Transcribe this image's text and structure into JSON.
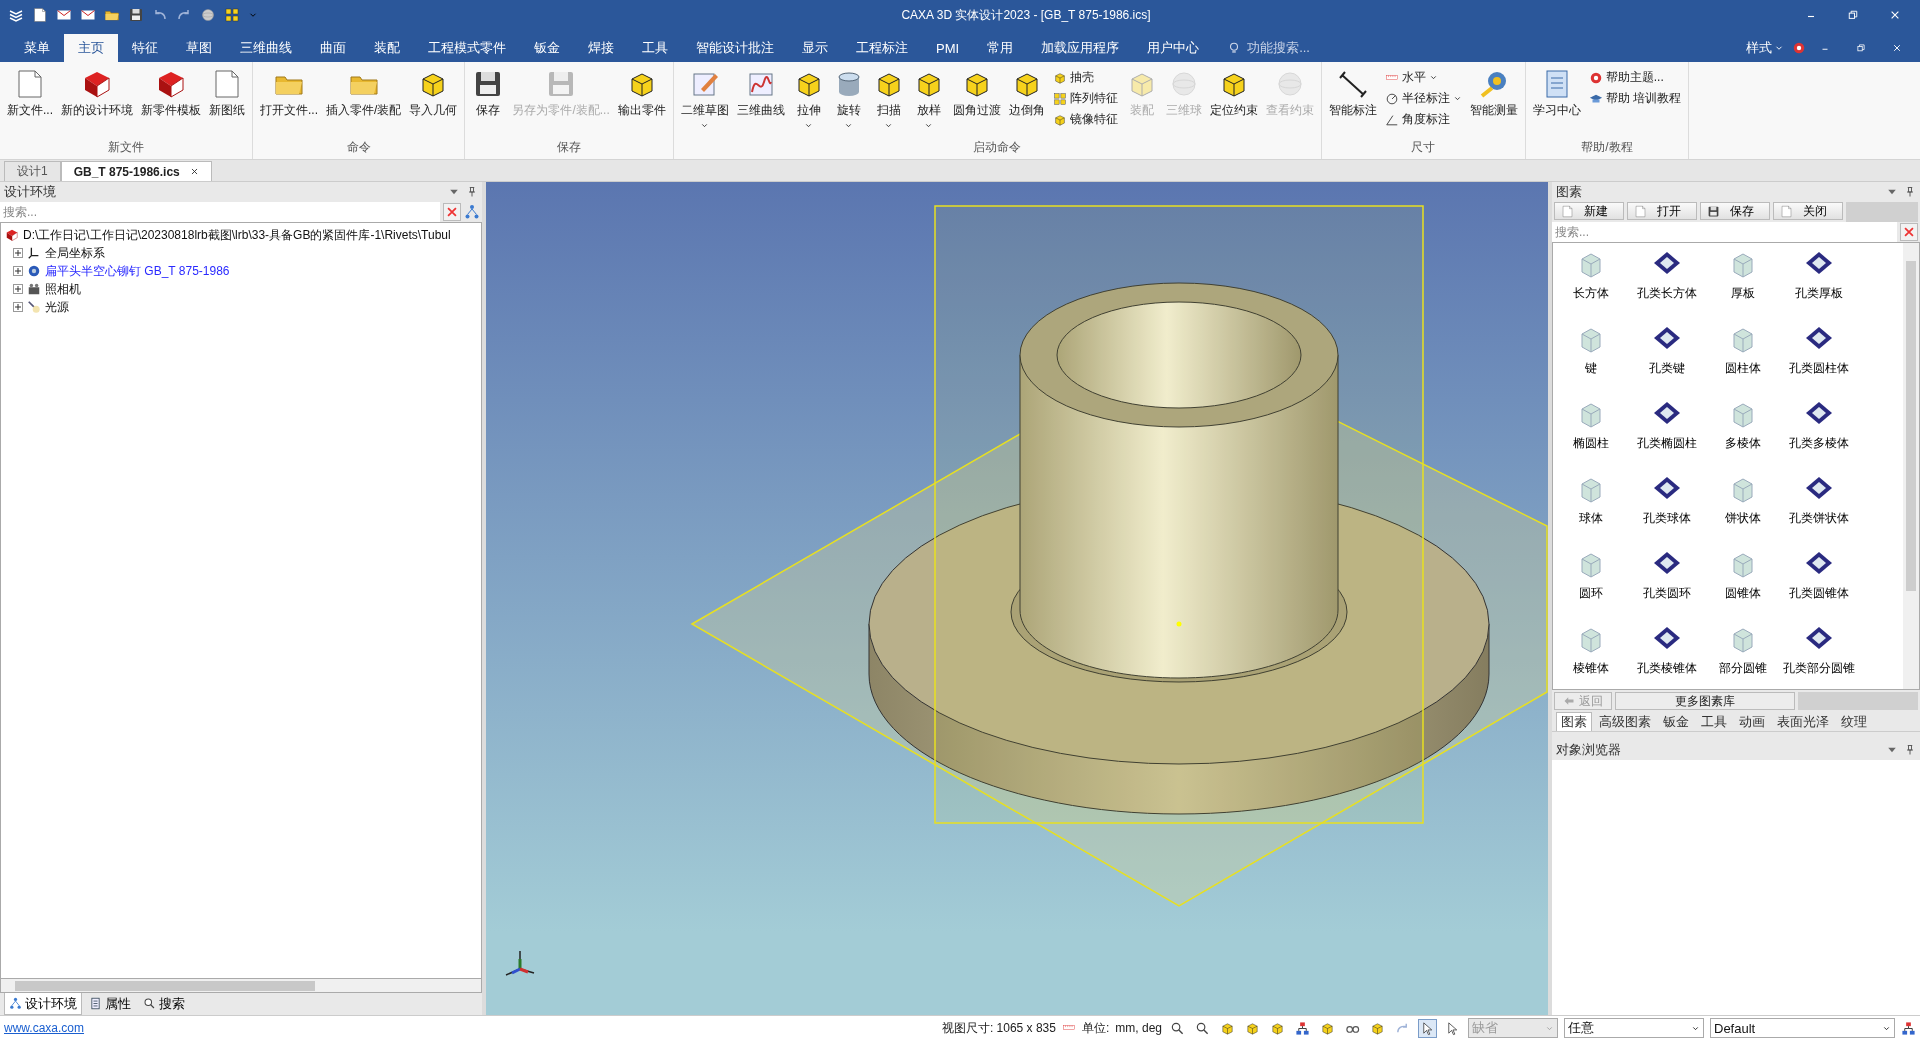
{
  "title_bar": {
    "title": "CAXA 3D 实体设计2023 - [GB_T 875-1986.ics]"
  },
  "menu_tabs": [
    {
      "label": "菜单",
      "selected": false
    },
    {
      "label": "主页",
      "selected": true
    },
    {
      "label": "特征",
      "selected": false
    },
    {
      "label": "草图",
      "selected": false
    },
    {
      "label": "三维曲线",
      "selected": false
    },
    {
      "label": "曲面",
      "selected": false
    },
    {
      "label": "装配",
      "selected": false
    },
    {
      "label": "工程模式零件",
      "selected": false
    },
    {
      "label": "钣金",
      "selected": false
    },
    {
      "label": "焊接",
      "selected": false
    },
    {
      "label": "工具",
      "selected": false
    },
    {
      "label": "智能设计批注",
      "selected": false
    },
    {
      "label": "显示",
      "selected": false
    },
    {
      "label": "工程标注",
      "selected": false
    },
    {
      "label": "PMI",
      "selected": false
    },
    {
      "label": "常用",
      "selected": false
    },
    {
      "label": "加载应用程序",
      "selected": false
    },
    {
      "label": "用户中心",
      "selected": false
    }
  ],
  "feature_search": {
    "placeholder": "功能搜索..."
  },
  "style_menu": {
    "label": "样式"
  },
  "ribbon": {
    "groups": [
      {
        "label": "新文件",
        "items": [
          {
            "kind": "large",
            "label": "新文件...",
            "caret": false,
            "disabled": false
          },
          {
            "kind": "large",
            "label": "新的设计环境",
            "caret": false,
            "disabled": false
          },
          {
            "kind": "large",
            "label": "新零件模板",
            "caret": false,
            "disabled": false
          },
          {
            "kind": "large",
            "label": "新图纸",
            "caret": false,
            "disabled": false
          }
        ]
      },
      {
        "label": "命令",
        "items": [
          {
            "kind": "large",
            "label": "打开文件...",
            "caret": false,
            "disabled": false
          },
          {
            "kind": "large",
            "label": "插入零件/装配",
            "caret": false,
            "disabled": false
          },
          {
            "kind": "large",
            "label": "导入几何",
            "caret": false,
            "disabled": false
          }
        ]
      },
      {
        "label": "保存",
        "items": [
          {
            "kind": "large",
            "label": "保存",
            "caret": false,
            "disabled": false
          },
          {
            "kind": "large",
            "label": "另存为零件/装配...",
            "caret": false,
            "disabled": true
          },
          {
            "kind": "large",
            "label": "输出零件",
            "caret": false,
            "disabled": false
          }
        ]
      },
      {
        "label": "启动命令",
        "items": [
          {
            "kind": "large",
            "label": "二维草图",
            "caret": true,
            "disabled": false
          },
          {
            "kind": "large",
            "label": "三维曲线",
            "caret": false,
            "disabled": false
          },
          {
            "kind": "large",
            "label": "拉伸",
            "caret": true,
            "disabled": false
          },
          {
            "kind": "large",
            "label": "旋转",
            "caret": true,
            "disabled": false
          },
          {
            "kind": "large",
            "label": "扫描",
            "caret": true,
            "disabled": false
          },
          {
            "kind": "large",
            "label": "放样",
            "caret": true,
            "disabled": false
          },
          {
            "kind": "large",
            "label": "圆角过渡",
            "caret": false,
            "disabled": false
          },
          {
            "kind": "large",
            "label": "边倒角",
            "caret": false,
            "disabled": false
          },
          {
            "kind": "stack",
            "items": [
              {
                "label": "抽壳",
                "caret": false,
                "disabled": false
              },
              {
                "label": "阵列特征",
                "caret": false,
                "disabled": false
              },
              {
                "label": "镜像特征",
                "caret": false,
                "disabled": false
              }
            ]
          },
          {
            "kind": "large",
            "label": "装配",
            "caret": false,
            "disabled": true
          },
          {
            "kind": "large",
            "label": "三维球",
            "caret": false,
            "disabled": true
          },
          {
            "kind": "large",
            "label": "定位约束",
            "caret": false,
            "disabled": false
          },
          {
            "kind": "large",
            "label": "查看约束",
            "caret": false,
            "disabled": true
          }
        ]
      },
      {
        "label": "尺寸",
        "items": [
          {
            "kind": "large",
            "label": "智能标注",
            "caret": false,
            "disabled": false
          },
          {
            "kind": "stack",
            "items": [
              {
                "label": "水平",
                "caret": true,
                "disabled": false
              },
              {
                "label": "半径标注",
                "caret": true,
                "disabled": false
              },
              {
                "label": "角度标注",
                "caret": false,
                "disabled": false
              }
            ]
          },
          {
            "kind": "large",
            "label": "智能测量",
            "caret": false,
            "disabled": false
          }
        ]
      },
      {
        "label": "帮助/教程",
        "items": [
          {
            "kind": "large",
            "label": "学习中心",
            "caret": false,
            "disabled": false
          },
          {
            "kind": "stack",
            "items": [
              {
                "label": "帮助主题...",
                "caret": false,
                "disabled": false
              },
              {
                "label": "帮助 培训教程",
                "caret": false,
                "disabled": false
              }
            ]
          }
        ]
      }
    ]
  },
  "doc_tabs": [
    {
      "label": "设计1",
      "selected": false,
      "closable": false
    },
    {
      "label": "GB_T 875-1986.ics",
      "selected": true,
      "closable": true
    }
  ],
  "left_panel": {
    "title": "设计环境",
    "search": {
      "placeholder": "搜索..."
    },
    "tree": {
      "label": "D:\\工作日记\\工作日记\\20230818lrb截图\\lrb\\33-具备GB的紧固件库-1\\Rivets\\Tubul",
      "children": [
        {
          "label": "全局坐标系",
          "expanded": false,
          "highlighted": false
        },
        {
          "label": "扁平头半空心铆钉 GB_T 875-1986",
          "expanded": false,
          "highlighted": true
        },
        {
          "label": "照相机",
          "expanded": false,
          "highlighted": false
        },
        {
          "label": "光源",
          "expanded": false,
          "highlighted": false
        }
      ]
    },
    "bottom_tabs": [
      {
        "label": "设计环境",
        "selected": true
      },
      {
        "label": "属性",
        "selected": false
      },
      {
        "label": "搜索",
        "selected": false
      }
    ]
  },
  "right_panel": {
    "title": "图素",
    "buttons": [
      "新建",
      "打开",
      "保存",
      "关闭"
    ],
    "search": {
      "placeholder": "搜索..."
    },
    "items": [
      "长方体",
      "孔类长方体",
      "厚板",
      "孔类厚板",
      "键",
      "孔类键",
      "圆柱体",
      "孔类圆柱体",
      "椭圆柱",
      "孔类椭圆柱",
      "多棱体",
      "孔类多棱体",
      "球体",
      "孔类球体",
      "饼状体",
      "孔类饼状体",
      "圆环",
      "孔类圆环",
      "圆锥体",
      "孔类圆锥体",
      "棱锥体",
      "孔类棱锥体",
      "部分圆锥",
      "孔类部分圆锥"
    ],
    "back": {
      "label": "返回",
      "disabled": true
    },
    "more": {
      "label": "更多图素库"
    },
    "tabs": [
      {
        "label": "图素",
        "selected": true
      },
      {
        "label": "高级图素",
        "selected": false
      },
      {
        "label": "钣金",
        "selected": false
      },
      {
        "label": "工具",
        "selected": false
      },
      {
        "label": "动画",
        "selected": false
      },
      {
        "label": "表面光泽",
        "selected": false
      },
      {
        "label": "纹理",
        "selected": false
      }
    ],
    "object_browser": {
      "title": "对象浏览器"
    }
  },
  "status_bar": {
    "link": "www.caxa.com",
    "view_size": "视图尺寸: 1065 x 835",
    "unit_label": "单位:",
    "unit_value": "mm, deg",
    "dropdowns": [
      {
        "value": "缺省",
        "disabled": true
      },
      {
        "value": "任意",
        "disabled": false
      },
      {
        "value": "Default",
        "disabled": false
      }
    ]
  }
}
